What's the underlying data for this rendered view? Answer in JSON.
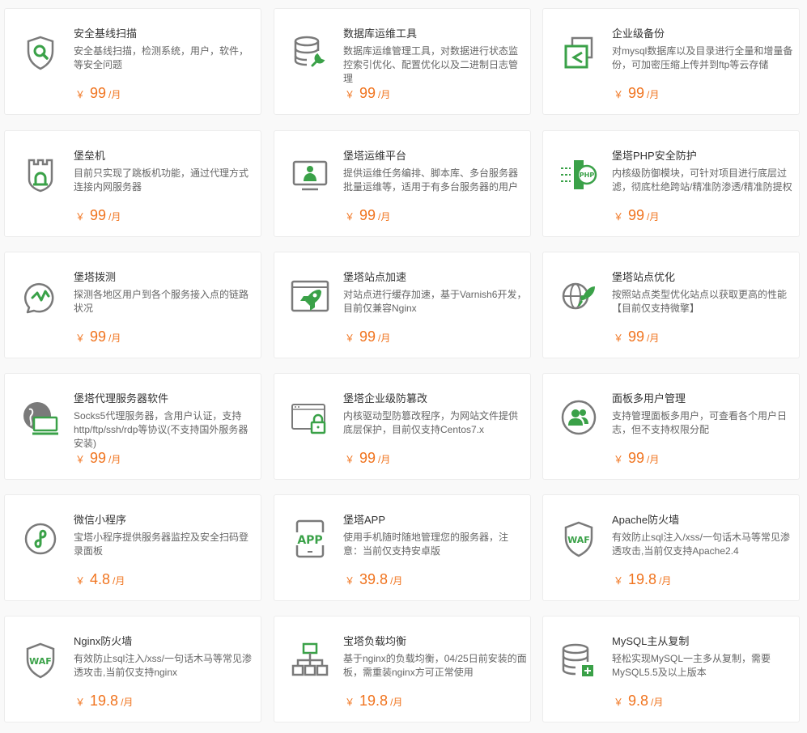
{
  "colors": {
    "accent_green": "#3aa148",
    "icon_gray": "#7a7a7a",
    "price_orange": "#f0741f",
    "title_text": "#333333",
    "desc_text": "#666666"
  },
  "currency_symbol": "￥",
  "unit_label": "/月",
  "plugins": [
    {
      "icon": "shield-search-icon",
      "title": "安全基线扫描",
      "desc": "安全基线扫描，检测系统，用户，软件，等安全问题",
      "price": "99"
    },
    {
      "icon": "database-tools-icon",
      "title": "数据库运维工具",
      "desc": "数据库运维管理工具，对数据进行状态监控索引优化、配置优化以及二进制日志管理",
      "price": "99"
    },
    {
      "icon": "backup-icon",
      "title": "企业级备份",
      "desc": "对mysql数据库以及目录进行全量和增量备份，可加密压缩上传并到ftp等云存储",
      "price": "99"
    },
    {
      "icon": "fortress-icon",
      "title": "堡垒机",
      "desc": "目前只实现了跳板机功能，通过代理方式连接内网服务器",
      "price": "99"
    },
    {
      "icon": "ops-platform-icon",
      "title": "堡塔运维平台",
      "desc": "提供运维任务编排、脚本库、多台服务器批量运维等，适用于有多台服务器的用户",
      "price": "99"
    },
    {
      "icon": "php-shield-icon",
      "title": "堡塔PHP安全防护",
      "desc": "内核级防御模块，可针对项目进行底层过滤，彻底杜绝跨站/精准防渗透/精准防提权",
      "price": "99"
    },
    {
      "icon": "probe-icon",
      "title": "堡塔拨测",
      "desc": "探测各地区用户到各个服务接入点的链路状况",
      "price": "99"
    },
    {
      "icon": "rocket-icon",
      "title": "堡塔站点加速",
      "desc": "对站点进行缓存加速，基于Varnish6开发，目前仅兼容Nginx",
      "price": "99"
    },
    {
      "icon": "globe-rocket-icon",
      "title": "堡塔站点优化",
      "desc": "按照站点类型优化站点以获取更高的性能【目前仅支持微擎】",
      "price": "99"
    },
    {
      "icon": "proxy-server-icon",
      "title": "堡塔代理服务器软件",
      "desc": "Socks5代理服务器，含用户认证，支持http/ftp/ssh/rdp等协议(不支持国外服务器安装)",
      "price": "99"
    },
    {
      "icon": "tamper-lock-icon",
      "title": "堡塔企业级防篡改",
      "desc": "内核驱动型防篡改程序，为网站文件提供底层保护，目前仅支持Centos7.x",
      "price": "99"
    },
    {
      "icon": "multi-user-icon",
      "title": "面板多用户管理",
      "desc": "支持管理面板多用户，可查看各个用户日志，但不支持权限分配",
      "price": "99"
    },
    {
      "icon": "mini-program-icon",
      "title": "微信小程序",
      "desc": "宝塔小程序提供服务器监控及安全扫码登录面板",
      "price": "4.8"
    },
    {
      "icon": "app-icon",
      "title": "堡塔APP",
      "desc": "使用手机随时随地管理您的服务器，注意：当前仅支持安卓版",
      "price": "39.8"
    },
    {
      "icon": "waf-apache-icon",
      "title": "Apache防火墙",
      "desc": "有效防止sql注入/xss/一句话木马等常见渗透攻击,当前仅支持Apache2.4",
      "price": "19.8"
    },
    {
      "icon": "waf-nginx-icon",
      "title": "Nginx防火墙",
      "desc": "有效防止sql注入/xss/一句话木马等常见渗透攻击,当前仅支持nginx",
      "price": "19.8"
    },
    {
      "icon": "load-balance-icon",
      "title": "宝塔负载均衡",
      "desc": "基于nginx的负载均衡，04/25日前安装的面板，需重装nginx方可正常使用",
      "price": "19.8"
    },
    {
      "icon": "mysql-replication-icon",
      "title": "MySQL主从复制",
      "desc": "轻松实现MySQL一主多从复制，需要MySQL5.5及以上版本",
      "price": "9.8"
    }
  ]
}
